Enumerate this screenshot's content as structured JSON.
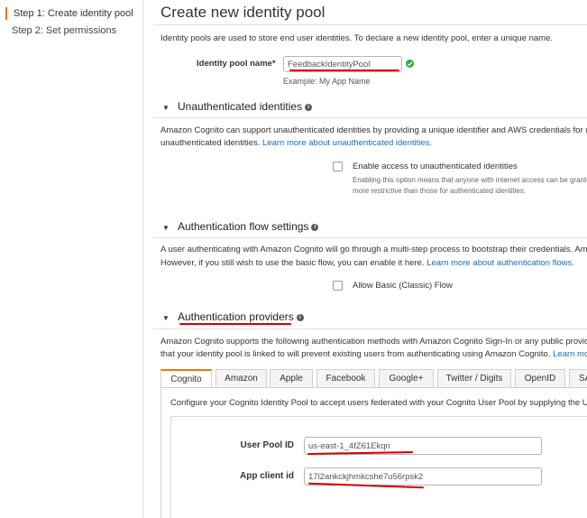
{
  "nav": {
    "steps": [
      "Step 1: Create identity pool",
      "Step 2: Set permissions"
    ]
  },
  "page": {
    "title": "Create new identity pool",
    "intro": "Identity pools are used to store end user identities. To declare a new identity pool, enter a unique name."
  },
  "pool_name": {
    "label": "Identity pool name*",
    "value": "FeedbackIdentityPool",
    "example": "Example: My App Name"
  },
  "unauth": {
    "title": "Unauthenticated identities",
    "desc_line1": "Amazon Cognito can support unauthenticated identities by providing a unique identifier and AWS credentials for us",
    "desc_line2": "unauthenticated identities.",
    "link": "Learn more about unauthenticated identities.",
    "checkbox_label": "Enable access to unauthenticated identities",
    "note_line1": "Enabling this option means that anyone with internet access can be grante",
    "note_line2": "more restrictive than those for authenticated identities."
  },
  "authflow": {
    "title": "Authentication flow settings",
    "desc_line1": "A user authenticating with Amazon Cognito will go through a multi-step process to bootstrap their credentials. Amaz",
    "desc_line2": "However, if you still wish to use the basic flow, you can enable it here.",
    "link": "Learn more about authentication flows.",
    "checkbox_label": "Allow Basic (Classic) Flow"
  },
  "providers": {
    "title": "Authentication providers",
    "desc_line1": "Amazon Cognito supports the following authentication methods with Amazon Cognito Sign-In or any public provide",
    "desc_line2": "that your identity pool is linked to will prevent existing users from authenticating using Amazon Cognito.",
    "link": "Learn more",
    "tabs": [
      "Cognito",
      "Amazon",
      "Apple",
      "Facebook",
      "Google+",
      "Twitter / Digits",
      "OpenID",
      "SA"
    ],
    "active_tab": "Cognito",
    "panel_desc": "Configure your Cognito Identity Pool to accept users federated with your Cognito User Pool by supplying the Use",
    "user_pool_id_label": "User Pool ID",
    "user_pool_id_value": "us-east-1_4fZ61Ekqn",
    "app_client_id_label": "App client id",
    "app_client_id_value": "17l2ankckjhmkcshe7u56rpsk2"
  },
  "colors": {
    "accent": "#e47911",
    "link": "#1a6db4",
    "annotation": "#d40000",
    "valid": "#2eaa3c"
  },
  "icons": [
    "caret-down-icon",
    "info-icon",
    "check-circle-icon"
  ]
}
